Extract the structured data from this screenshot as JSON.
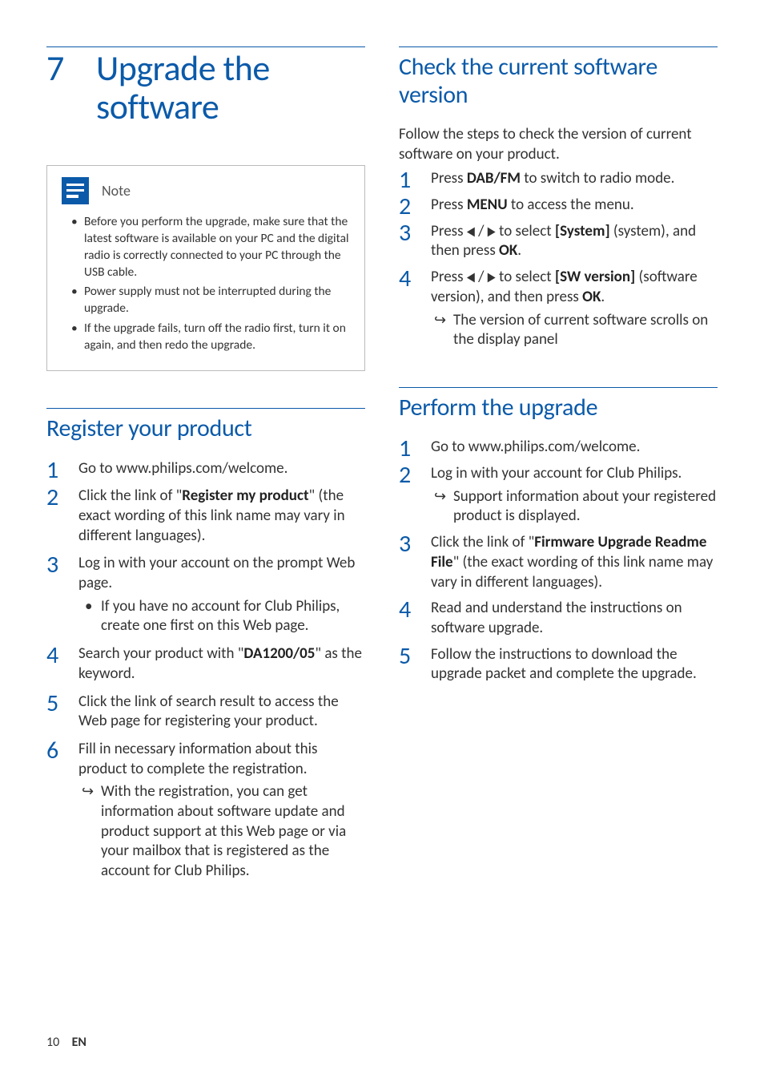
{
  "chapter": {
    "number": "7",
    "title_line1": "Upgrade the",
    "title_line2": "software"
  },
  "note": {
    "label": "Note",
    "items": [
      "Before you perform the upgrade, make sure that the latest software is available on your PC and the digital radio is correctly connected to your PC through the USB cable.",
      "Power supply must not be interrupted during the upgrade.",
      "If the upgrade fails, turn off the radio first, turn it on again, and then redo the upgrade."
    ]
  },
  "register": {
    "heading": "Register your product",
    "steps": [
      {
        "text_pre": "Go to www.philips.com/welcome."
      },
      {
        "text_pre": "Click the link of \"",
        "bold": "Register my product",
        "text_post": "\" (the exact wording of this link name may vary in different languages)."
      },
      {
        "text_pre": "Log in with your account on the prompt Web page.",
        "sub_bullets": [
          "If you have no account for Club Philips, create one first on this Web page."
        ]
      },
      {
        "text_pre": "Search your product with \"",
        "bold": "DA1200/05",
        "text_post": "\" as the keyword."
      },
      {
        "text_pre": "Click the link of search result to access the Web page for registering your product."
      },
      {
        "text_pre": "Fill in necessary information about this product to complete the registration.",
        "sub_arrows": [
          "With the registration, you can get information about software update and product support at this Web page or via your mailbox that is registered as the account for Club Philips."
        ]
      }
    ]
  },
  "check": {
    "heading_line1": "Check the current software",
    "heading_line2": "version",
    "intro": "Follow the steps to check the version of current software on your product.",
    "steps": [
      {
        "pre": "Press ",
        "bold": "DAB/FM",
        "post": " to switch to radio mode."
      },
      {
        "pre": "Press ",
        "bold": "MENU",
        "post": " to access the menu."
      },
      {
        "pre": "Press ",
        "tri": true,
        "post1": " to select ",
        "bold1": "[System]",
        "post2": " (system), and then press ",
        "bold2": "OK",
        "post3": "."
      },
      {
        "pre": "Press ",
        "tri": true,
        "post1": " to select ",
        "bold1": "[SW version]",
        "post2": " (software version), and then press ",
        "bold2": "OK",
        "post3": ".",
        "sub_arrows": [
          "The version of current software scrolls on the display panel"
        ]
      }
    ]
  },
  "perform": {
    "heading": "Perform the upgrade",
    "steps": [
      {
        "text_pre": "Go to www.philips.com/welcome."
      },
      {
        "text_pre": "Log in with your account for Club Philips.",
        "sub_arrows": [
          "Support information about your registered product is displayed."
        ]
      },
      {
        "text_pre": "Click the link of \"",
        "bold": "Firmware Upgrade Readme File",
        "text_post": "\" (the exact wording of this link name may vary in different languages)."
      },
      {
        "text_pre": "Read and understand the instructions on software upgrade."
      },
      {
        "text_pre": "Follow the instructions to download the upgrade packet and complete the upgrade."
      }
    ]
  },
  "footer": {
    "page": "10",
    "lang": "EN"
  }
}
